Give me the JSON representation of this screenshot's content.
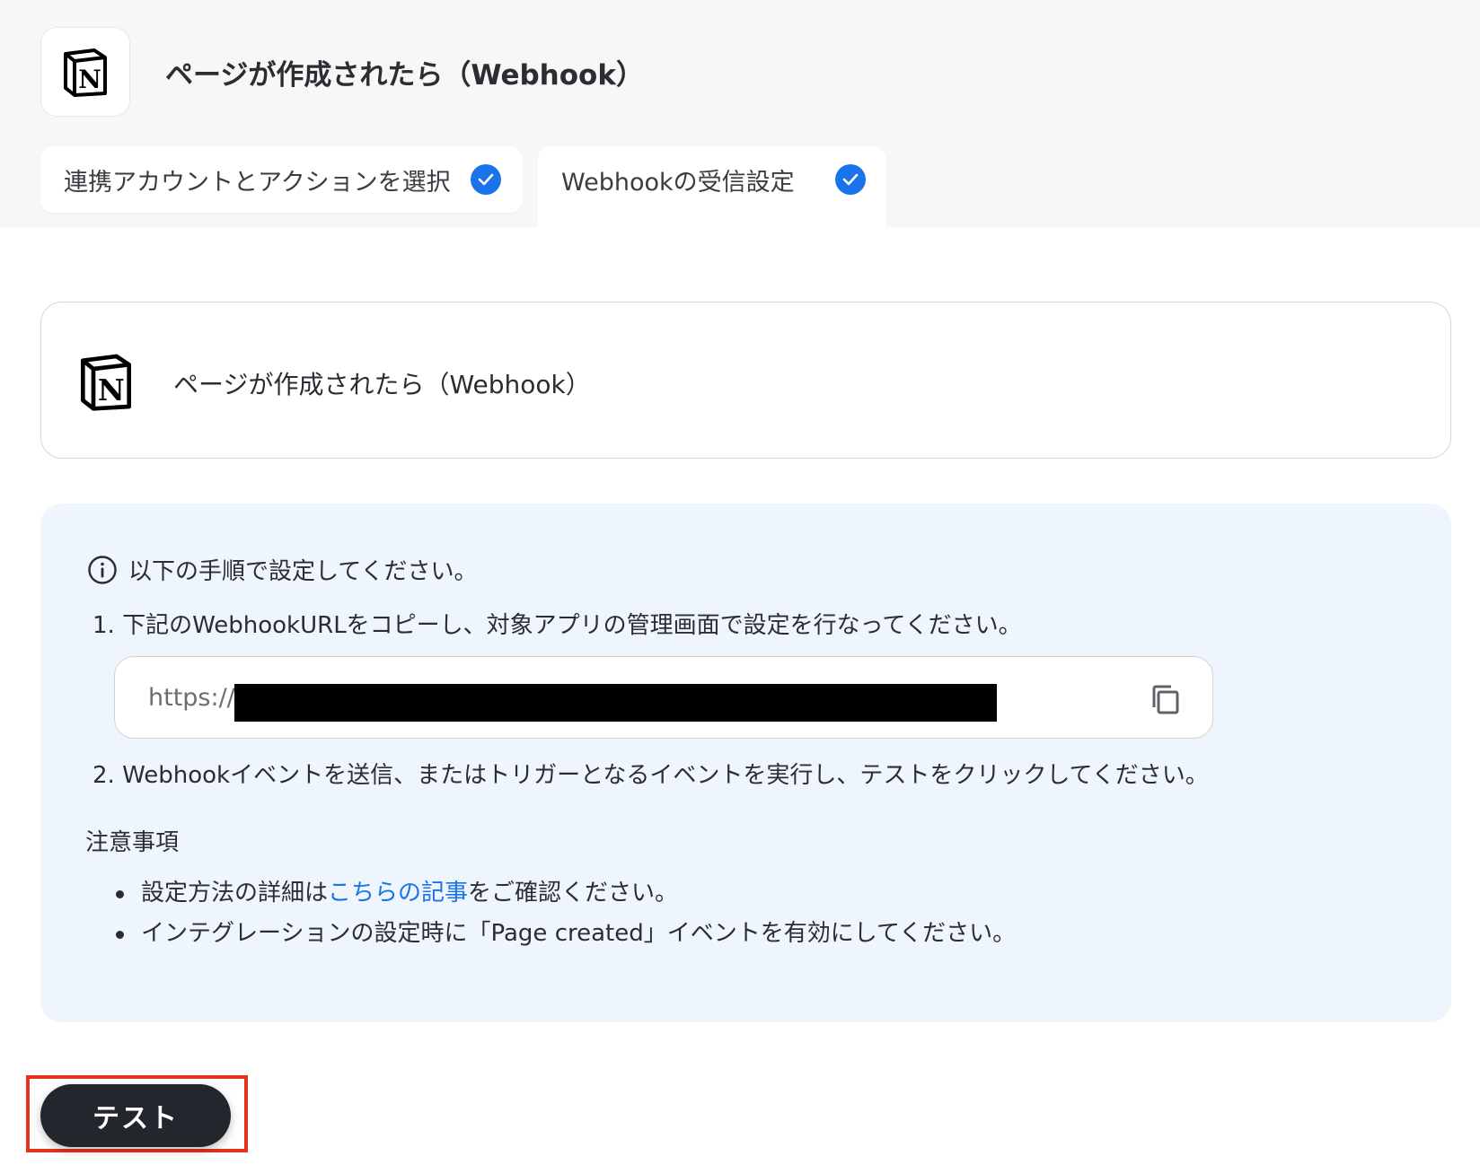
{
  "header": {
    "app_icon": "notion-logo",
    "title": "ページが作成されたら（Webhook）"
  },
  "tabs": [
    {
      "label": "連携アカウントとアクションを選択",
      "completed": true
    },
    {
      "label": "Webhookの受信設定",
      "completed": true,
      "active": true
    }
  ],
  "trigger": {
    "app_icon": "notion-logo",
    "title": "ページが作成されたら（Webhook）"
  },
  "instructions": {
    "heading_icon": "info-icon",
    "heading": "以下の手順で設定してください。",
    "step1": "1. 下記のWebhookURLをコピーし、対象アプリの管理画面で設定を行なってください。",
    "url_visible": "https://",
    "copy_icon": "copy-icon",
    "step2": "2. Webhookイベントを送信、またはトリガーとなるイベントを実行し、テストをクリックしてください。",
    "notes_title": "注意事項",
    "note1_prefix": "設定方法の詳細は",
    "note1_link": "こちらの記事",
    "note1_suffix": "をご確認ください。",
    "note2": "インテグレーションの設定時に「Page created」イベントを有効にしてください。"
  },
  "actions": {
    "test_label": "テスト"
  },
  "colors": {
    "accent": "#1a73e8",
    "info_bg": "#eef5fd",
    "button_bg": "#23262d",
    "highlight": "#e8321e"
  }
}
